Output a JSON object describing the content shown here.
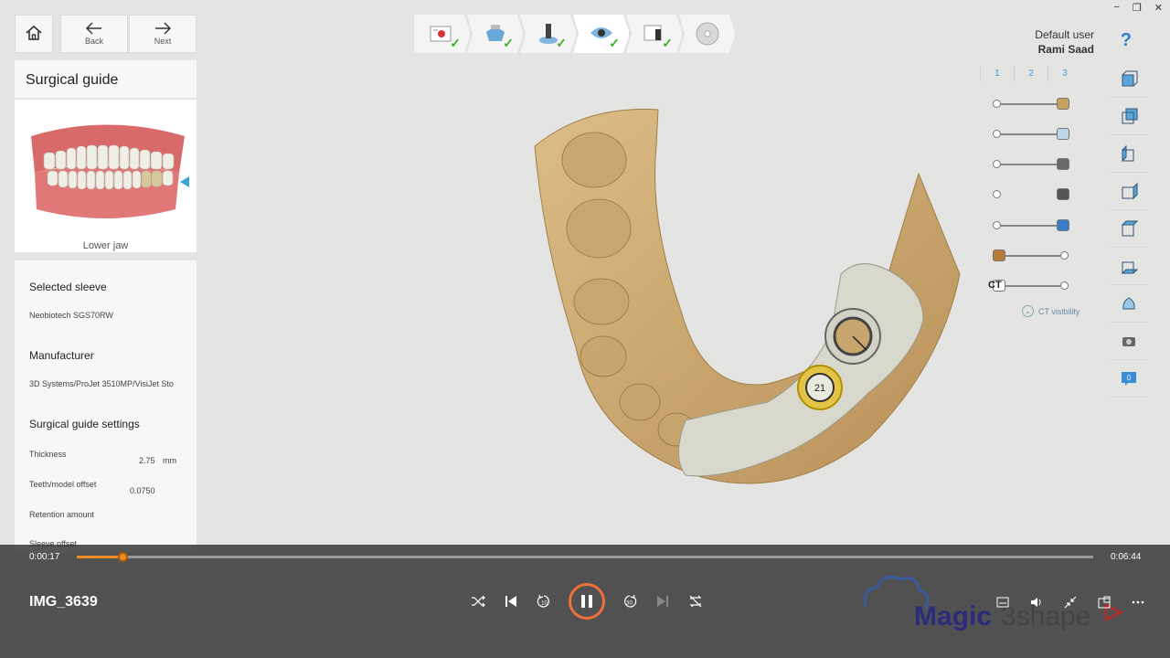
{
  "window": {
    "minimize": "−",
    "restore": "❐",
    "close": "✕"
  },
  "nav": {
    "back": "Back",
    "next": "Next"
  },
  "user": {
    "label": "Default user",
    "name": "Rami Saad",
    "help": "?"
  },
  "panel": {
    "title": "Surgical guide",
    "jaw_label": "Lower jaw",
    "selected_sleeve_header": "Selected sleeve",
    "selected_sleeve": "Neobiotech SGS70RW",
    "manufacturer_header": "Manufacturer",
    "manufacturer": "3D Systems/ProJet 3510MP/VisiJet Sto",
    "settings_header": "Surgical guide settings",
    "thickness_label": "Thickness",
    "thickness_value": "2.75",
    "thickness_unit": "mm",
    "offset_label": "Teeth/model offset",
    "offset_value": "0.0750",
    "retention_label": "Retention amount",
    "sleeve_offset_label": "Sleeve offset"
  },
  "layers": {
    "tabs": [
      "1",
      "2",
      "3"
    ],
    "ct_label": "CT",
    "ct_visibility": "CT visibility",
    "sliders": [
      {
        "level": 0.0,
        "color": "#c8a060"
      },
      {
        "level": 0.0,
        "color": "#bcd8e8"
      },
      {
        "level": 0.0,
        "color": "#6a6a6a"
      },
      {
        "level": 0.0,
        "color": "#555555"
      },
      {
        "level": 0.0,
        "color": "#3a7cc8"
      },
      {
        "level": 1.0,
        "color": "#b87a38"
      },
      {
        "level": 1.0,
        "color": "#ffffff"
      }
    ]
  },
  "implant_label": "21",
  "player": {
    "current_time": "0:00:17",
    "total_time": "0:06:44",
    "progress": 0.045,
    "file_name": "IMG_3639"
  },
  "watermark": {
    "left": "Magic",
    "right": "3shape"
  },
  "colors": {
    "accent": "#f08a24",
    "model": "#d2b07a",
    "guide": "#d8d8cc",
    "link": "#4a9cd2"
  }
}
